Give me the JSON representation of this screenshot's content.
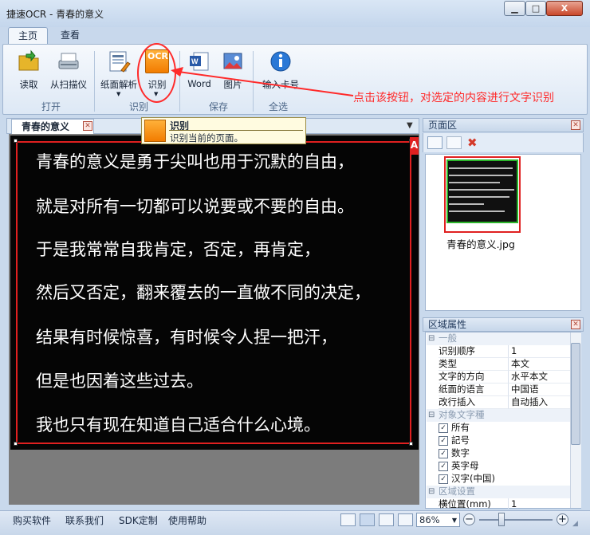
{
  "window": {
    "title": "捷速OCR - 青春的意义",
    "min_glyph": "▁",
    "max_glyph": "□",
    "close_glyph": "X"
  },
  "tabs": [
    {
      "label": "主页"
    },
    {
      "label": "查看"
    }
  ],
  "ribbon": {
    "buttons": {
      "read": "读取",
      "scan": "从扫描仪",
      "analyze": "纸面解析",
      "recognize": "识别",
      "word": "Word",
      "image": "图片",
      "serial": "输入卡号"
    },
    "groups": {
      "open": "打开",
      "recognize": "识别",
      "save": "保存",
      "select_all": "全选"
    },
    "ocr_icon_text": "OCR"
  },
  "tooltip": {
    "title": "识别",
    "description": "识别当前的页面。"
  },
  "annotation": {
    "text": "点击该按钮，对选定的内容进行文字识别"
  },
  "document": {
    "tab_label": "青春的意义",
    "region_tag": "A",
    "lines": [
      "青春的意义是勇于尖叫也用于沉默的自由，",
      "就是对所有一切都可以说要或不要的自由。",
      "于是我常常自我肯定，否定，再肯定，",
      "然后又否定，翻来覆去的一直做不同的决定，",
      "结果有时候惊喜，有时候令人捏一把汗，",
      "但是也因着这些过去。",
      "我也只有现在知道自己适合什么心境。"
    ]
  },
  "page_panel": {
    "title": "页面区",
    "thumb_name": "青春的意义.jpg"
  },
  "props_panel": {
    "title": "区域属性",
    "categories": {
      "general": "一般",
      "char_types": "对象文字種",
      "region": "区域设置"
    },
    "general": [
      {
        "name": "识别顺序",
        "value": "1"
      },
      {
        "name": "类型",
        "value": "本文"
      },
      {
        "name": "文字的方向",
        "value": "水平本文"
      },
      {
        "name": "纸面的语言",
        "value": "中国语"
      },
      {
        "name": "改行插入",
        "value": "自动插入"
      }
    ],
    "char_types": [
      {
        "label": "所有",
        "checked": true
      },
      {
        "label": "記号",
        "checked": true
      },
      {
        "label": "数字",
        "checked": true
      },
      {
        "label": "英字母",
        "checked": true
      },
      {
        "label": "汉字(中国)",
        "checked": true
      }
    ],
    "region": [
      {
        "name": "横位置(mm)",
        "value": "1"
      }
    ]
  },
  "statusbar": {
    "links": [
      "购买软件",
      "联系我们",
      "SDK定制",
      "使用帮助"
    ],
    "zoom": "86%",
    "zoom_level": 0.3
  }
}
